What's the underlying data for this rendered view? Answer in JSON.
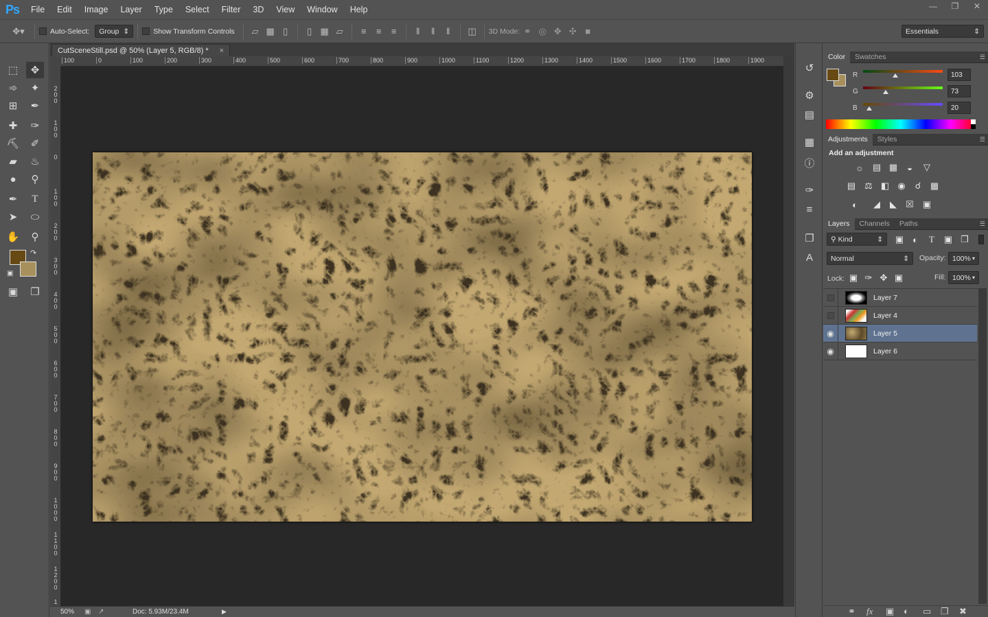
{
  "app": {
    "logo": "Ps"
  },
  "menu": [
    "File",
    "Edit",
    "Image",
    "Layer",
    "Type",
    "Select",
    "Filter",
    "3D",
    "View",
    "Window",
    "Help"
  ],
  "window_controls": [
    "minimize",
    "restore",
    "close"
  ],
  "options": {
    "auto_select_label": "Auto-Select:",
    "auto_select_checked": false,
    "group_value": "Group",
    "transform_label": "Show Transform Controls",
    "transform_checked": false,
    "mode3d_label": "3D Mode:",
    "workspace": "Essentials"
  },
  "document": {
    "tab_title": "CutSceneStill.psd @ 50% (Layer 5, RGB/8) *",
    "close_glyph": "×",
    "ruler_h": [
      "100",
      "0",
      "100",
      "200",
      "300",
      "400",
      "500",
      "600",
      "700",
      "800",
      "900",
      "1000",
      "1100",
      "1200",
      "1300",
      "1400",
      "1500",
      "1600",
      "1700",
      "1800",
      "1900"
    ],
    "ruler_v": [
      "2 0 0",
      "1 0 0",
      "0",
      "1 0 0",
      "2 0 0",
      "3 0 0",
      "4 0 0",
      "5 0 0",
      "6 0 0",
      "7 0 0",
      "8 0 0",
      "9 0 0",
      "1 0 0 0",
      "1 1 0 0",
      "1 2 0 0",
      "1"
    ]
  },
  "status": {
    "zoom": "50%",
    "doc_info": "Doc: 5.93M/23.4M"
  },
  "colors": {
    "foreground": "#674914",
    "background": "#a8905c",
    "texture_light": "#c3a872",
    "texture_dark": "#3d3220"
  },
  "color_panel": {
    "tabs": [
      "Color",
      "Swatches"
    ],
    "r_label": "R",
    "g_label": "G",
    "b_label": "B",
    "r": "103",
    "g": "73",
    "b": "20",
    "r_frac": 0.404,
    "g_frac": 0.286,
    "b_frac": 0.078
  },
  "adjustments_panel": {
    "tabs": [
      "Adjustments",
      "Styles"
    ],
    "heading": "Add an adjustment"
  },
  "layers_panel": {
    "tabs": [
      "Layers",
      "Channels",
      "Paths"
    ],
    "filter_kind": "Kind",
    "blend_mode": "Normal",
    "opacity_label": "Opacity:",
    "opacity": "100%",
    "lock_label": "Lock:",
    "fill_label": "Fill:",
    "fill": "100%",
    "layers": [
      {
        "name": "Layer 7",
        "visible": false,
        "selected": false
      },
      {
        "name": "Layer 4",
        "visible": false,
        "selected": false
      },
      {
        "name": "Layer 5",
        "visible": true,
        "selected": true
      },
      {
        "name": "Layer 6",
        "visible": true,
        "selected": false
      }
    ]
  }
}
